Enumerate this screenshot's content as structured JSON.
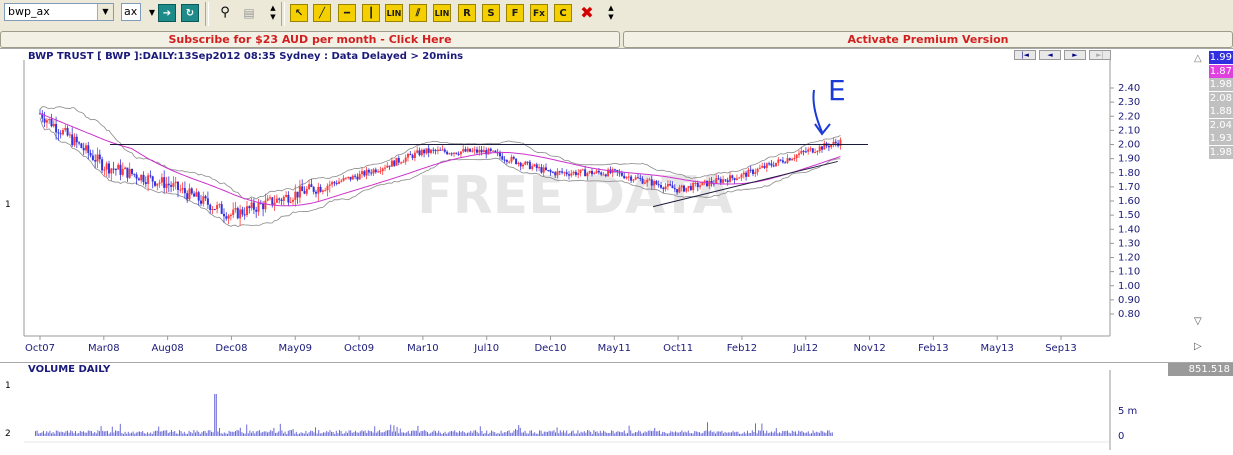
{
  "toolbar": {
    "symbol_value": "bwp_ax",
    "exchange_value": "ax",
    "icons": [
      "go-arrow-icon",
      "refresh-icon",
      "binoculars-icon",
      "print-icon",
      "cursor-icon",
      "trendline-icon",
      "horizontal-line-icon",
      "vertical-line-icon",
      "linear-regression-icon",
      "parallel-lines-icon",
      "linear-regression-channel-icon",
      "retracement-icon",
      "speed-resistance-icon",
      "fibonacci-fan-icon",
      "fibonacci-ext-icon",
      "copy-icon",
      "delete-icon"
    ],
    "labels": {
      "lin1": "LIN",
      "lin2": "LIN",
      "r": "R",
      "s": "S",
      "f1": "F",
      "f2": "Fx",
      "c": "C"
    }
  },
  "banners": {
    "subscribe": "Subscribe for $23 AUD per month - Click Here",
    "premium": "Activate Premium Version"
  },
  "colors": {
    "up_bar": "#ff3b3b",
    "down_bar": "#3333dd",
    "moving_average": "#cc33cc",
    "bollinger": "#8a8a8a",
    "hline": "#1a1a3a",
    "annotation": "#1a3ad8",
    "volume": "#6a6ad8"
  },
  "chart": {
    "title": "BWP TRUST [ BWP ]:DAILY:13Sep2012 08:35 Sydney : Data Delayed > 20mins",
    "watermark": "FREE DATA",
    "pane_number": "1",
    "nav_buttons": [
      "|◄",
      "◄",
      "►",
      "►|"
    ]
  },
  "side_values": [
    {
      "text": "1.99",
      "bg": "#3030e0"
    },
    {
      "text": "1.87",
      "bg": "#e040e0"
    },
    {
      "text": "1.98",
      "bg": "#c0c0c0"
    },
    {
      "text": "2.08",
      "bg": "#c0c0c0"
    },
    {
      "text": "1.88",
      "bg": "#c0c0c0"
    },
    {
      "text": "2.04",
      "bg": "#c0c0c0"
    },
    {
      "text": "1.93",
      "bg": "#c0c0c0"
    },
    {
      "text": "1.98",
      "bg": "#c0c0c0"
    }
  ],
  "volume": {
    "title": "VOLUME DAILY",
    "value_box": "851.518",
    "pane_numbers": [
      "1",
      "2"
    ],
    "y_ticks": [
      "5 m",
      "0"
    ]
  },
  "chart_data": {
    "type": "candlestick",
    "x_tick_labels": [
      "Oct07",
      "Mar08",
      "Aug08",
      "Dec08",
      "May09",
      "Oct09",
      "Mar10",
      "Jul10",
      "Dec10",
      "May11",
      "Oct11",
      "Feb12",
      "Jul12",
      "Nov12",
      "Feb13",
      "May13",
      "Sep13"
    ],
    "y_tick_labels": [
      "2.40",
      "2.30",
      "2.20",
      "2.10",
      "2.00",
      "1.90",
      "1.80",
      "1.70",
      "1.60",
      "1.50",
      "1.40",
      "1.30",
      "1.20",
      "1.10",
      "1.00",
      "0.90",
      "0.80"
    ],
    "ylim": [
      0.8,
      2.4
    ],
    "horizontal_line": 2.0,
    "approx_close_path": [
      {
        "x": "Oct07",
        "y": 2.22
      },
      {
        "x": "Mar08",
        "y": 1.85
      },
      {
        "x": "Aug08",
        "y": 1.72
      },
      {
        "x": "Dec08",
        "y": 1.5
      },
      {
        "x": "May09",
        "y": 1.65
      },
      {
        "x": "Oct09",
        "y": 1.78
      },
      {
        "x": "Mar10",
        "y": 1.95
      },
      {
        "x": "Jul10",
        "y": 1.95
      },
      {
        "x": "Dec10",
        "y": 1.8
      },
      {
        "x": "May11",
        "y": 1.8
      },
      {
        "x": "Oct11",
        "y": 1.68
      },
      {
        "x": "Feb12",
        "y": 1.78
      },
      {
        "x": "Jul12",
        "y": 1.95
      },
      {
        "x": "Sep12",
        "y": 2.02
      }
    ],
    "annotation": "E"
  }
}
